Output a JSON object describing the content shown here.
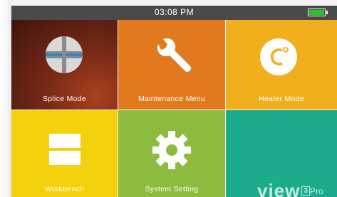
{
  "statusbar": {
    "time": "03:08 PM",
    "battery_icon": "battery-full-icon",
    "battery_color": "#22c522"
  },
  "tiles": [
    {
      "label": "Splice Mode",
      "icon": "fiber-splice-icon",
      "color": "#7a2a16"
    },
    {
      "label": "Maintenance Menu",
      "icon": "wrench-icon",
      "color": "#e17a1f"
    },
    {
      "label": "Heater Mode",
      "icon": "celsius-icon",
      "color": "#f1af1e"
    },
    {
      "label": "Workbench",
      "icon": "workbench-icon",
      "color": "#f3d10c"
    },
    {
      "label": "System Setting",
      "icon": "gear-icon",
      "color": "#8dbb3e"
    }
  ],
  "brand": {
    "main": "view",
    "number": "3",
    "suffix": "Pro",
    "color": "#1cab8b"
  }
}
